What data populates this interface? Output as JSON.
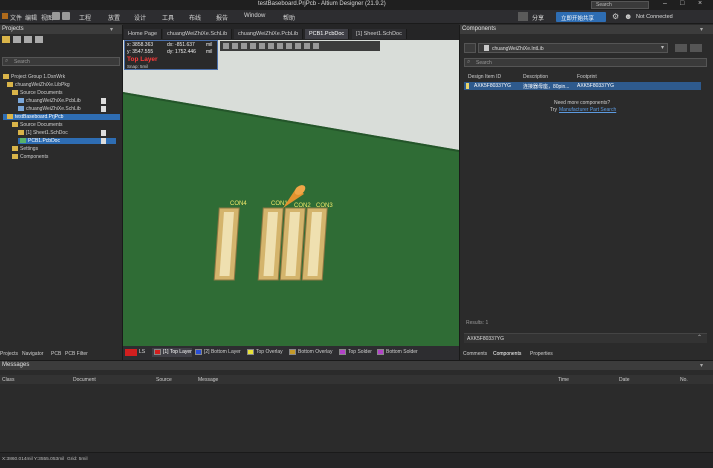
{
  "app": {
    "title": "testBaseboard.PrjPcb - Altium Designer (21.9.2)",
    "search_placeholder": "Search",
    "share_label": "分享",
    "share_btn": "立即开始共享",
    "status": "Not Connected",
    "colors": {
      "accent": "#2e6db3",
      "board": "#2e6b34",
      "canvas": "#d7dcd7"
    }
  },
  "menu": {
    "items": [
      "文件",
      "编辑",
      "视图",
      "工程",
      "放置",
      "设计",
      "工具",
      "布线",
      "报告",
      "Window",
      "帮助"
    ]
  },
  "tabs": [
    {
      "label": "Home Page",
      "active": false
    },
    {
      "label": "chuangWeiZhiXe.SchLib",
      "active": false
    },
    {
      "label": "chuangWeiZhiXe.PcbLib",
      "active": false
    },
    {
      "label": "PCB1.PcbDoc",
      "active": true
    },
    {
      "label": "[1] Sheet1.SchDoc",
      "active": false
    }
  ],
  "projects_panel": {
    "title": "Projects",
    "search_placeholder": "Search",
    "tree": [
      {
        "label": "Project Group 1.DsnWrk",
        "kind": "folder",
        "level": 0
      },
      {
        "label": "chuangWeiZhiXe.LibPkg",
        "kind": "folder",
        "level": 1
      },
      {
        "label": "Source Documents",
        "kind": "folder",
        "level": 2
      },
      {
        "label": "chuangWeiZhiXe.PcbLib",
        "kind": "doc",
        "level": 3
      },
      {
        "label": "chuangWeiZhiXe.SchLib",
        "kind": "doc",
        "level": 3
      },
      {
        "label": "testBaseboard.PrjPcb",
        "kind": "folder",
        "level": 1,
        "selected": true
      },
      {
        "label": "Source Documents",
        "kind": "folder",
        "level": 2
      },
      {
        "label": "Sheet1.SchDoc",
        "kind": "doc",
        "level": 3,
        "prefix": "[1]"
      },
      {
        "label": "PCB1.PcbDoc",
        "kind": "pcb",
        "level": 3,
        "selected": true
      },
      {
        "label": "Settings",
        "kind": "folder",
        "level": 2
      },
      {
        "label": "Components",
        "kind": "folder",
        "level": 2
      }
    ],
    "bottom_tabs": [
      "Projects",
      "Navigator",
      "PCB",
      "PCB Filter"
    ]
  },
  "hud": {
    "x": "x: 3858.363",
    "dx": "dx: -851.637",
    "unit1": "mil",
    "y": "y: 3547.555",
    "dy": "dy: 1752.446",
    "unit2": "mil",
    "layer": "Top Layer",
    "snap": "Snap: 5mil"
  },
  "components_on_board": [
    "CON4",
    "CON1",
    "CON2",
    "CON3"
  ],
  "layers": [
    {
      "label": "LS",
      "color": "#d21f1f"
    },
    {
      "label": "[1] Top Layer",
      "color": "#d21f1f",
      "active": true
    },
    {
      "label": "[2] Bottom Layer",
      "color": "#2a4fd6"
    },
    {
      "label": "Top Overlay",
      "color": "#e8e23a"
    },
    {
      "label": "Bottom Overlay",
      "color": "#c49a2a"
    },
    {
      "label": "Top Solder",
      "color": "#b243c8"
    },
    {
      "label": "Bottom Solder",
      "color": "#b243c8"
    }
  ],
  "components_panel": {
    "title": "Components",
    "library": "chuangWeiZhiXe.IntLib",
    "search_placeholder": "Search",
    "columns": [
      "Design Item ID",
      "Description",
      "Footprint"
    ],
    "rows": [
      {
        "id": "AXK5F80337YG",
        "desc": "连接器母座，80pin...",
        "footprint": "AXK5F80337YG"
      }
    ],
    "need_more": "Need more components?",
    "try_text": "Try",
    "search_link": "Manufacturer Part Search",
    "results": "Results: 1",
    "selected_item": "AXK5F80337YG",
    "bottom_tabs": [
      "Comments",
      "Components",
      "Properties"
    ]
  },
  "messages_panel": {
    "title": "Messages",
    "columns": [
      "Class",
      "Document",
      "Source",
      "Message",
      "Time",
      "Date",
      "No."
    ]
  },
  "statusbar": {
    "coords": "X:3860.014mil Y:3555.053mil",
    "grid": "Grid: 5mil"
  }
}
